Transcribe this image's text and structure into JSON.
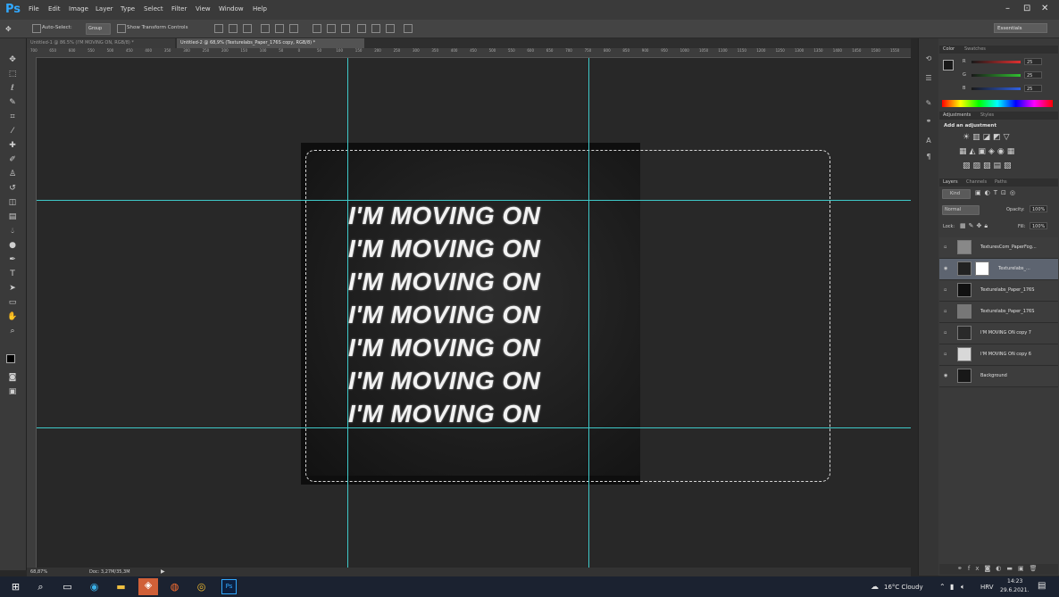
{
  "app": {
    "logo": "Ps",
    "menu": [
      "File",
      "Edit",
      "Image",
      "Layer",
      "Type",
      "Select",
      "Filter",
      "View",
      "Window",
      "Help"
    ],
    "window_controls": [
      "–",
      "⊡",
      "✕"
    ]
  },
  "options_bar": {
    "auto_select_label": "Auto-Select:",
    "auto_select_value": "Group",
    "show_transform_label": "Show Transform Controls",
    "workspace": "Essentials"
  },
  "tabs": [
    {
      "label": "Untitled-1 @ 86.5% (I'M MOVING ON, RGB/8) *"
    },
    {
      "label": "Untitled-2 @ 68,9% (Texturelabs_Paper_176S copy, RGB/8) *"
    }
  ],
  "ruler_ticks": [
    "700",
    "650",
    "600",
    "550",
    "500",
    "450",
    "400",
    "350",
    "300",
    "250",
    "200",
    "150",
    "100",
    "50",
    "0",
    "50",
    "100",
    "150",
    "200",
    "250",
    "300",
    "350",
    "400",
    "450",
    "500",
    "550",
    "600",
    "650",
    "700",
    "750",
    "800",
    "850",
    "900",
    "950",
    "1000",
    "1050",
    "1100",
    "1150",
    "1200",
    "1250",
    "1300",
    "1350",
    "1400",
    "1450",
    "1500",
    "1550"
  ],
  "canvas": {
    "lines": [
      "I'M MOVING ON",
      "I'M MOVING ON",
      "I'M MOVING ON",
      "I'M MOVING ON",
      "I'M MOVING ON",
      "I'M MOVING ON",
      "I'M MOVING ON"
    ]
  },
  "status": {
    "zoom": "68,87%",
    "doc": "Doc: 3,27M/35,3M"
  },
  "color_panel": {
    "tabs": [
      "Color",
      "Swatches"
    ],
    "channels": [
      {
        "label": "R",
        "value": "25",
        "color": "#e03030"
      },
      {
        "label": "G",
        "value": "25",
        "color": "#30c030"
      },
      {
        "label": "B",
        "value": "25",
        "color": "#3060e0"
      }
    ]
  },
  "adjustments_panel": {
    "tabs": [
      "Adjustments",
      "Styles"
    ],
    "title": "Add an adjustment"
  },
  "layers_panel": {
    "tabs": [
      "Layers",
      "Channels",
      "Paths"
    ],
    "kind_label": "Kind",
    "blend_mode": "Normal",
    "opacity_label": "Opacity:",
    "opacity_value": "100%",
    "lock_label": "Lock:",
    "fill_label": "Fill:",
    "fill_value": "100%",
    "layers": [
      {
        "name": "TexturesCom_PaperFog...",
        "thumb": "#888888",
        "visible": false,
        "active": false
      },
      {
        "name": "Texturelabs_...",
        "thumb": "#222222",
        "visible": true,
        "active": true
      },
      {
        "name": "Texturelabs_Paper_176S",
        "thumb": "#101010",
        "visible": false,
        "active": false
      },
      {
        "name": "Texturelabs_Paper_176S",
        "thumb": "#777777",
        "visible": false,
        "active": false
      },
      {
        "name": "I'M MOVING ON copy 7",
        "thumb": "#2a2a2a",
        "visible": false,
        "active": false
      },
      {
        "name": "I'M MOVING ON copy 6",
        "thumb": "#d8d8d8",
        "visible": false,
        "active": false
      },
      {
        "name": "Background",
        "thumb": "#181818",
        "visible": true,
        "active": false
      }
    ]
  },
  "taskbar": {
    "weather": "16°C Cloudy",
    "lang": "HRV",
    "time": "14:23",
    "date": "29.6.2021."
  }
}
